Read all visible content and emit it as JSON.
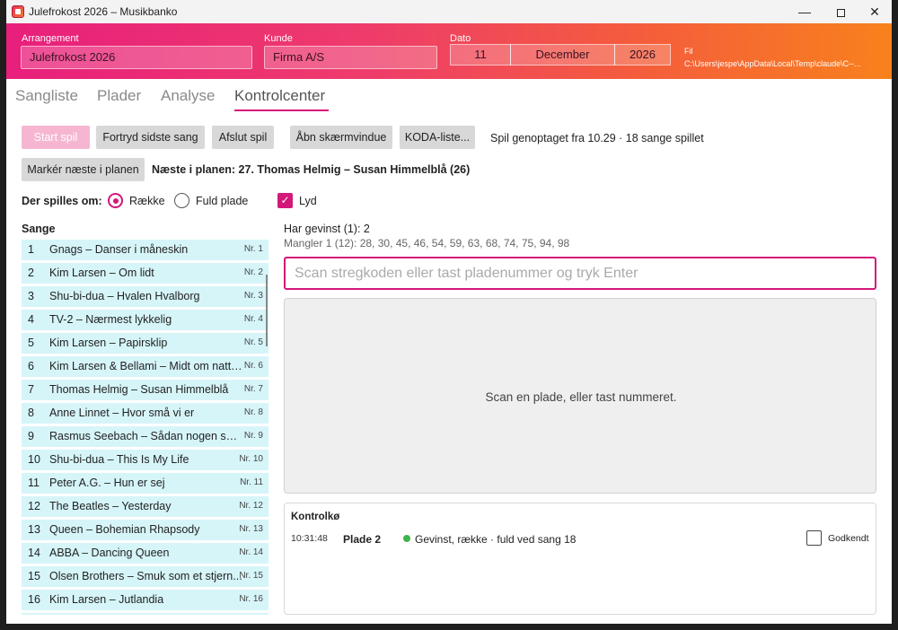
{
  "window": {
    "title": "Julefrokost 2026 – Musikbanko",
    "minimize": "—",
    "close": "✕"
  },
  "header": {
    "arrangement_label": "Arrangement",
    "arrangement_value": "Julefrokost 2026",
    "kunde_label": "Kunde",
    "kunde_value": "Firma A/S",
    "dato_label": "Dato",
    "date_day": "11",
    "date_month": "December",
    "date_year": "2026",
    "file_label": "Fil",
    "file_path": "C:\\Users\\jespe\\AppData\\Local\\Temp\\claude\\C--..."
  },
  "tabs": [
    "Sangliste",
    "Plader",
    "Analyse",
    "Kontrolcenter"
  ],
  "toolbar": {
    "start": "Start spil",
    "undo": "Fortryd sidste sang",
    "end": "Afslut spil",
    "screen": "Åbn skærmvindue",
    "koda": "KODA-liste...",
    "status": "Spil genoptaget fra 10.29 · 18 sange spillet",
    "mark_next": "Markér næste i planen",
    "next_plan": "Næste i planen: 27. Thomas Helmig – Susan Himmelblå (26)"
  },
  "mode": {
    "label": "Der spilles om:",
    "raekke": "Række",
    "fuld": "Fuld plade",
    "lyd": "Lyd",
    "check_glyph": "✓"
  },
  "songs": {
    "title": "Sange",
    "items": [
      {
        "num": "1",
        "name": "Gnags – Danser i måneskin",
        "nr": "Nr. 1"
      },
      {
        "num": "2",
        "name": "Kim Larsen – Om lidt",
        "nr": "Nr. 2"
      },
      {
        "num": "3",
        "name": "Shu-bi-dua – Hvalen Hvalborg",
        "nr": "Nr. 3"
      },
      {
        "num": "4",
        "name": "TV-2 – Nærmest lykkelig",
        "nr": "Nr. 4"
      },
      {
        "num": "5",
        "name": "Kim Larsen – Papirsklip",
        "nr": "Nr. 5"
      },
      {
        "num": "6",
        "name": "Kim Larsen & Bellami – Midt om natten",
        "nr": "Nr. 6"
      },
      {
        "num": "7",
        "name": "Thomas Helmig – Susan Himmelblå",
        "nr": "Nr. 7"
      },
      {
        "num": "8",
        "name": "Anne Linnet – Hvor små vi er",
        "nr": "Nr. 8"
      },
      {
        "num": "9",
        "name": "Rasmus Seebach – Sådan nogen som...",
        "nr": "Nr. 9"
      },
      {
        "num": "10",
        "name": "Shu-bi-dua – This Is My Life",
        "nr": "Nr. 10"
      },
      {
        "num": "11",
        "name": "Peter A.G. – Hun er sej",
        "nr": "Nr. 11"
      },
      {
        "num": "12",
        "name": "The Beatles – Yesterday",
        "nr": "Nr. 12"
      },
      {
        "num": "13",
        "name": "Queen – Bohemian Rhapsody",
        "nr": "Nr. 13"
      },
      {
        "num": "14",
        "name": "ABBA – Dancing Queen",
        "nr": "Nr. 14"
      },
      {
        "num": "15",
        "name": "Olsen Brothers – Smuk som et stjern...",
        "nr": "Nr. 15"
      },
      {
        "num": "16",
        "name": "Kim Larsen – Jutlandia",
        "nr": "Nr. 16"
      }
    ]
  },
  "game": {
    "gevinst": "Har gevinst (1): 2",
    "mangler": "Mangler 1 (12): 28, 30, 45, 46, 54, 59, 63, 68, 74, 75, 94, 98",
    "scan_placeholder": "Scan stregkoden eller tast pladenummer og tryk Enter",
    "scan_message": "Scan en plade, eller tast nummeret."
  },
  "kontrol": {
    "title": "Kontrolkø",
    "row": {
      "time": "10:31:48",
      "plade": "Plade 2",
      "text": "Gevinst, række · fuld ved sang 18",
      "godkendt": "Godkendt"
    }
  }
}
